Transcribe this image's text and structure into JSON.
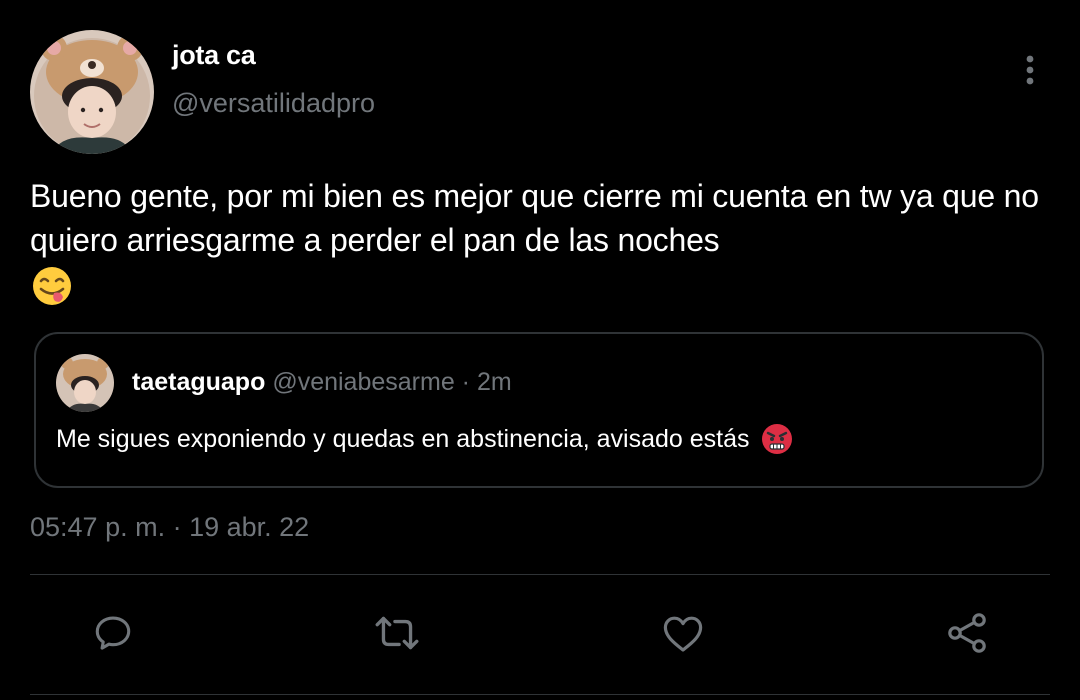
{
  "tweet": {
    "author": {
      "display_name": "jota ca",
      "handle": "@versatilidadpro"
    },
    "text": "Bueno gente, por mi bien es mejor que cierre mi cuenta en tw ya que no quiero arriesgarme a perder el pan de las noches",
    "emoji": "yum-face-emoji",
    "timestamp": "05:47 p. m. · 19 abr. 22"
  },
  "quoted_tweet": {
    "display_name": "taetaguapo",
    "handle": "@veniabesarme",
    "separator": " · ",
    "time_ago": "2m",
    "text": "Me sigues exponiendo y quedas en abstinencia, avisado estás",
    "emoji": "angry-face-emoji"
  },
  "actions": [
    {
      "icon": "reply-icon"
    },
    {
      "icon": "retweet-icon"
    },
    {
      "icon": "like-icon"
    },
    {
      "icon": "share-icon"
    }
  ],
  "colors": {
    "background": "#000000",
    "primary_text": "#ffffff",
    "secondary_text": "#71767b",
    "border": "#2f3336"
  }
}
